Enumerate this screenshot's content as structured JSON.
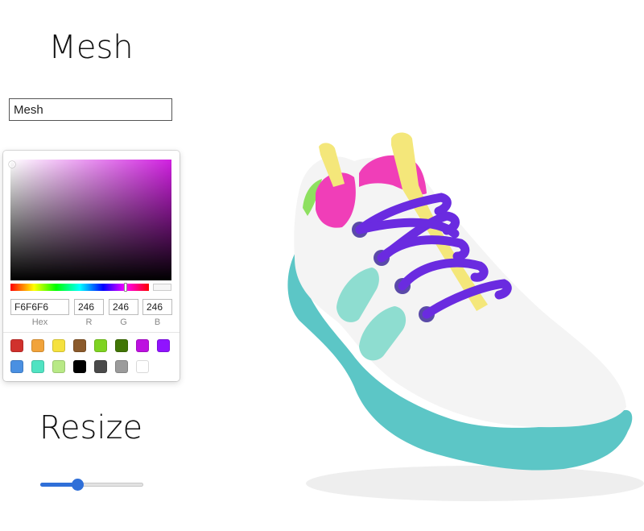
{
  "mesh_panel": {
    "title": "Mesh",
    "name_input_value": "Mesh"
  },
  "color_picker": {
    "current_color": "#F6F6F6",
    "hue_color": "#d020e0",
    "hex_value": "F6F6F6",
    "r_value": "246",
    "g_value": "246",
    "b_value": "246",
    "hex_label": "Hex",
    "r_label": "R",
    "g_label": "G",
    "b_label": "B",
    "swatches": [
      "#D0312D",
      "#F1A33B",
      "#F5E13E",
      "#8B5A2B",
      "#7ED321",
      "#417505",
      "#BD10E0",
      "#9013FE",
      "#4A90E2",
      "#50E3C2",
      "#B8E986",
      "#000000",
      "#4A4A4A",
      "#9B9B9B",
      "#FFFFFF"
    ]
  },
  "resize_panel": {
    "title": "Resize",
    "slider_value": 0.36
  },
  "viewport": {
    "object": "sneaker-3d-model",
    "colors": {
      "upper": "#F4F4F4",
      "sole": "#5CC6C6",
      "collar": "#F03EB8",
      "pull_tabs": "#F4E77A",
      "laces": "#6A2BE0",
      "side_stripes": "#8EDDD0",
      "heel_accent": "#8EE060"
    }
  }
}
